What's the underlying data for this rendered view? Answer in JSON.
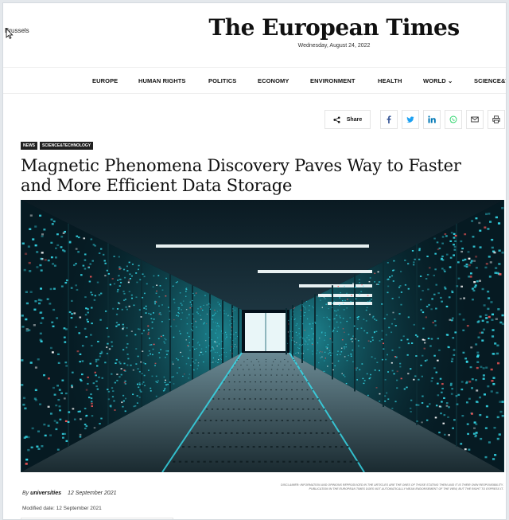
{
  "header": {
    "location": "Brussels",
    "brand": "The European Times",
    "date": "Wednesday, August 24, 2022"
  },
  "nav": {
    "items": [
      {
        "label": "EUROPE"
      },
      {
        "label": "HUMAN RIGHTS"
      },
      {
        "label": "POLITICS"
      },
      {
        "label": "ECONOMY"
      },
      {
        "label": "ENVIRONMENT"
      },
      {
        "label": "HEALTH"
      },
      {
        "label": "WORLD ⌄"
      },
      {
        "label": "SCIENCE&TE"
      }
    ]
  },
  "share": {
    "label": "Share",
    "icons": [
      "share-icon",
      "facebook-icon",
      "twitter-icon",
      "linkedin-icon",
      "whatsapp-icon",
      "email-icon",
      "print-icon"
    ]
  },
  "article": {
    "tags": [
      "NEWS",
      "SCIENCE&TECHNOLOGY"
    ],
    "title": "Magnetic Phenomena Discovery Paves Way to Faster and More Efficient Data Storage",
    "credit": "DISCLAIMER: INFORMATION AND OPINIONS REPRODUCED IN THE ARTICLES ARE THE ONES OF THOSE STATING THEM AND IT IS THEIR OWN RESPONSIBILITY. PUBLICATION IN THE EUROPEAN TIMES DOES NOT AUTOMATICALLY MEAN ENDORSEMENT OF THE VIEW, BUT THE RIGHT TO EXPRESS IT.",
    "by_prefix": "By",
    "author": "universities",
    "published": "12 September 2021",
    "modified": "Modified date: 12 September 2021"
  },
  "colors": {
    "accent_blue": "#1da1f2",
    "facebook": "#3b5998",
    "linkedin": "#0077b5",
    "whatsapp": "#25d366",
    "server_glow": "#36e0f0"
  }
}
